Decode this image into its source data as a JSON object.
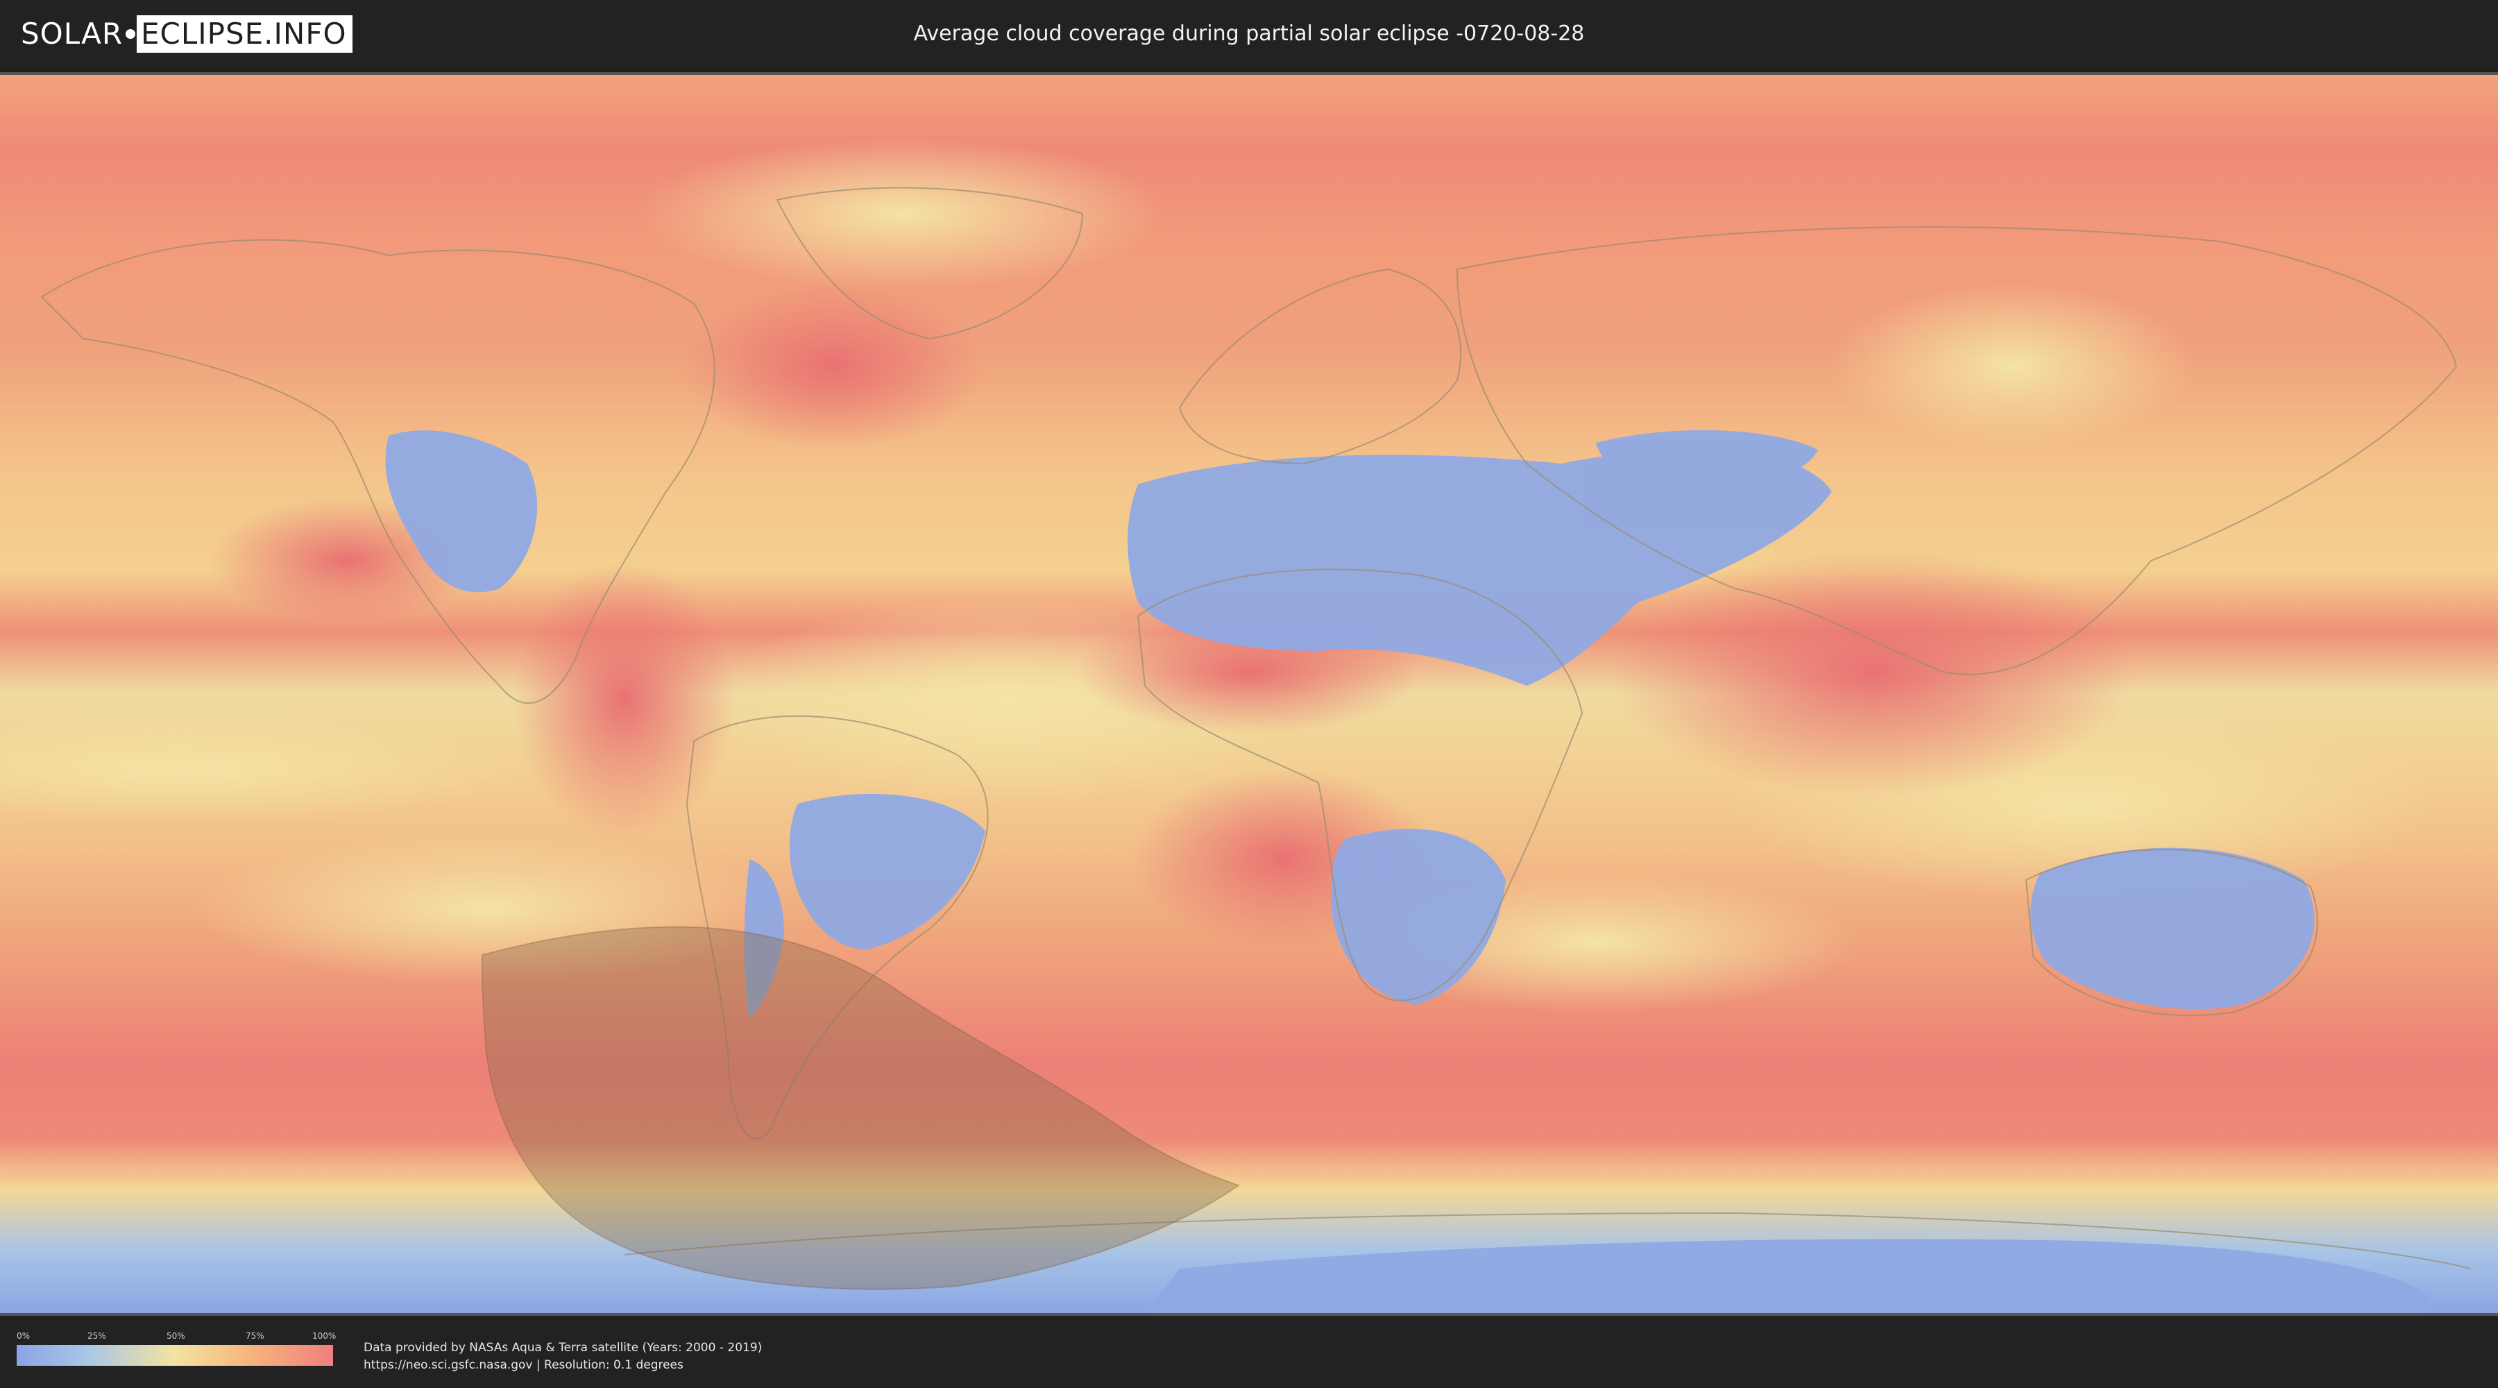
{
  "logo": {
    "left": "SOLAR",
    "right": "ECLIPSE.INFO"
  },
  "title": "Average cloud coverage during partial solar eclipse -0720-08-28",
  "legend": {
    "ticks": [
      "0%",
      "25%",
      "50%",
      "75%",
      "100%"
    ],
    "colors": [
      "#8aa4e6",
      "#a8c6e6",
      "#f3e3a0",
      "#f6b27c",
      "#ef7f7f"
    ]
  },
  "source": {
    "line1": "Data provided by NASAs Aqua & Terra satellite (Years: 2000 - 2019)",
    "line2": "https://neo.sci.gsfc.nasa.gov | Resolution: 0.1 degrees"
  },
  "map": {
    "eclipse_shadow_color": "#8a6a4a"
  }
}
